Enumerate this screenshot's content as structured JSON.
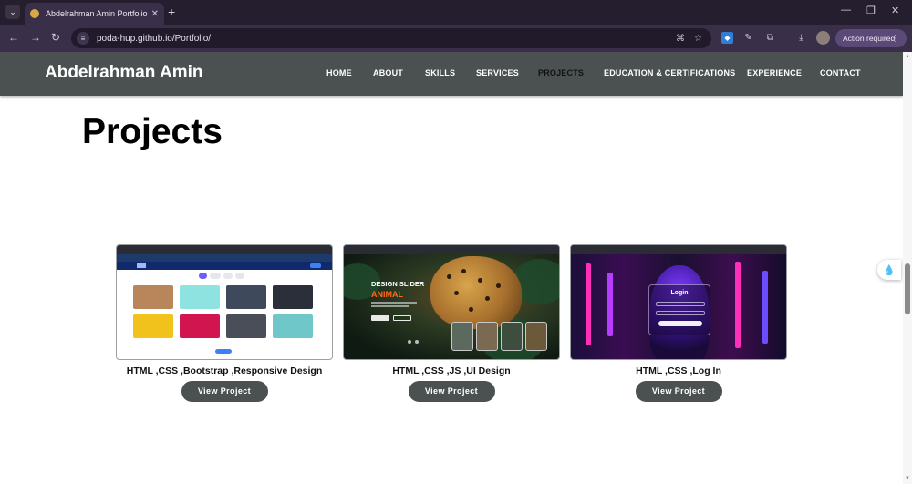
{
  "browser": {
    "tab_title": "Abdelrahman Amin Portfolio",
    "new_tab_label": "+",
    "url": "poda-hup.github.io/Portfolio/",
    "action_required_label": "Action required"
  },
  "site": {
    "brand": "Abdelrahman Amin",
    "nav": [
      {
        "label": "HOME"
      },
      {
        "label": "ABOUT"
      },
      {
        "label": "SKILLS"
      },
      {
        "label": "SERVICES"
      },
      {
        "label": "PROJECTS",
        "active": true
      },
      {
        "label": "EDUCATION & CERTIFICATIONS"
      },
      {
        "label": "EXPERIENCE"
      },
      {
        "label": "CONTACT"
      }
    ],
    "section_title": "Projects"
  },
  "projects": [
    {
      "caption": "HTML ,CSS ,Bootstrap ,Responsive Design",
      "button": "View Project"
    },
    {
      "caption": "HTML ,CSS ,JS ,UI Design",
      "button": "View Project",
      "screenshot_text": {
        "title": "DESIGN SLIDER",
        "subtitle": "ANIMAL"
      }
    },
    {
      "caption": "HTML ,CSS ,Log In",
      "button": "View Project",
      "screenshot_text": {
        "title": "Login"
      }
    }
  ],
  "colors": {
    "header_bg": "#4b5150",
    "button_bg": "#4b5150",
    "browser_frame": "#3a2f49",
    "accent_orange": "#ff6a1a"
  },
  "icons": [
    "tab-search-icon",
    "back-icon",
    "forward-icon",
    "reload-icon",
    "translate-icon",
    "bookmark-star-icon",
    "extension-icon",
    "eyedropper-icon",
    "puzzle-icon",
    "download-icon",
    "profile-avatar",
    "menu-dots-icon",
    "minimize-icon",
    "restore-icon",
    "close-icon"
  ]
}
